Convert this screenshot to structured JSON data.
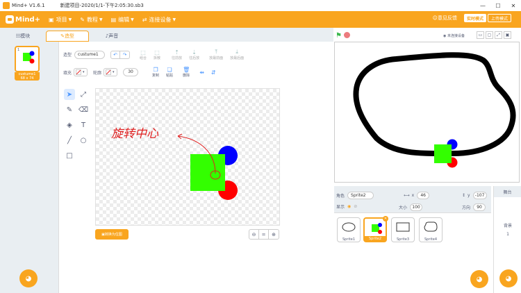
{
  "window": {
    "app_name": "Mind+ V1.6.1",
    "document_title": "新建项目-2020/1/1-下午2:05:30.sb3",
    "minimize": "—",
    "maximize": "☐",
    "close": "✕"
  },
  "menubar": {
    "logo": "Mind+",
    "items": [
      {
        "label": "项目",
        "glyph": "▣"
      },
      {
        "label": "教程",
        "glyph": "✎"
      },
      {
        "label": "编辑",
        "glyph": "▤"
      },
      {
        "label": "连接设备",
        "glyph": "⇄"
      }
    ],
    "feedback": "意见反馈",
    "mode_realtime": "实时模式",
    "mode_upload": "上传模式"
  },
  "tabs": {
    "blocks": "模块",
    "costumes": "造型",
    "sounds": "声音"
  },
  "costume_list": {
    "number": "1",
    "name": "custume1",
    "size": "68 x 74"
  },
  "editor": {
    "shape_label": "造型",
    "costume_name": "custume1",
    "undo": "↶",
    "redo": "↷",
    "group": "组合",
    "ungroup": "拆散",
    "forward": "往前放",
    "backward": "往后放",
    "front": "放最前面",
    "back": "放最后面",
    "fill_label": "填充",
    "outline_label": "轮廓",
    "outline_width": "30",
    "copy": "复制",
    "paste": "粘贴",
    "delete": "删除",
    "convert_bitmap": "转换为位图"
  },
  "stage": {
    "connection": "未连接设备"
  },
  "sprite_info": {
    "sprite_label": "角色",
    "sprite_name": "Sprite2",
    "x_label": "x",
    "x": "46",
    "y_label": "y",
    "y": "-107",
    "show_label": "显示",
    "size_label": "大小",
    "size": "100",
    "direction_label": "方向",
    "direction": "90"
  },
  "sprites": [
    {
      "name": "Sprite1"
    },
    {
      "name": "Sprite2"
    },
    {
      "name": "Sprite3"
    },
    {
      "name": "Sprite4"
    }
  ],
  "stage_panel": {
    "tab": "舞台",
    "backdrop_label": "背景",
    "backdrop_count": "1"
  },
  "annotation": {
    "text": "旋转中心"
  },
  "colors": {
    "accent": "#f9a51f",
    "green": "#33ff00",
    "blue": "#0000ff",
    "red": "#ff0000",
    "annotation": "#e02020"
  }
}
